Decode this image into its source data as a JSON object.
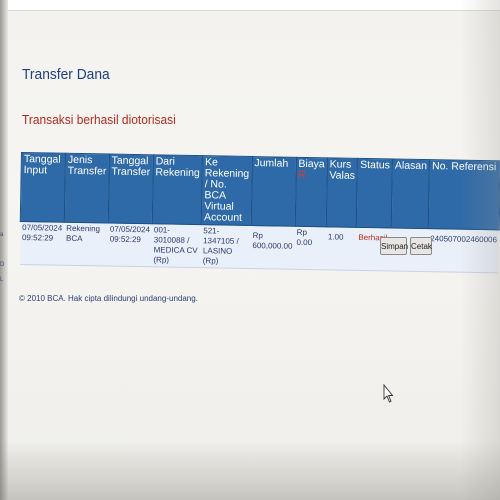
{
  "page": {
    "title": "Transfer Dana",
    "success_message": "Transaksi berhasil diotorisasi"
  },
  "table": {
    "headers": [
      "Tanggal Input",
      "Jenis Transfer",
      "Tanggal Transfer",
      "Dari Rekening",
      "Ke Rekening / No. BCA Virtual Account",
      "Jumlah",
      "Biaya",
      "Kurs Valas",
      "Status",
      "Alasan",
      "No. Referensi"
    ],
    "biaya_marker": "R",
    "row": {
      "tanggal_input": "07/05/2024 09:52:29",
      "jenis_transfer": "Rekening BCA",
      "tanggal_transfer": "07/05/2024 09:52:29",
      "dari_rekening": "001-3010088 / MEDICA CV (Rp)",
      "ke_rekening": "521-1347105 / LASINO (Rp)",
      "jumlah": "Rp 600,000.00",
      "biaya": "Rp 0.00",
      "kurs_valas": "1.00",
      "status": "Berhasil",
      "alasan": "-",
      "no_referensi": "240507002460006"
    }
  },
  "buttons": {
    "simpan": "Simpan",
    "cetak": "Cetak"
  },
  "footer": {
    "copyright": "© 2010 BCA. Hak cipta dilindungi undang-undang."
  },
  "colors": {
    "header_bg": "#2f6aa8",
    "title": "#1f3f7f",
    "success": "#b32a1e",
    "row_bg": "#eaf0f9"
  },
  "icons": {
    "cursor": "mouse-pointer-icon"
  }
}
